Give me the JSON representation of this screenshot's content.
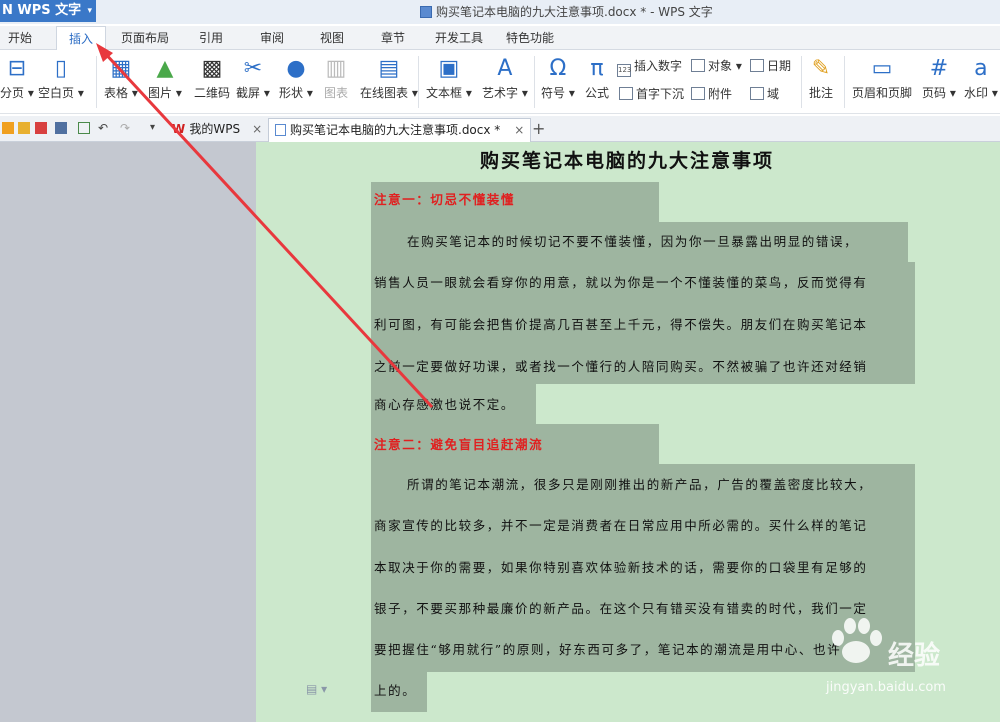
{
  "app": {
    "name": "WPS 文字"
  },
  "window": {
    "title": "购买笔记本电脑的九大注意事项.docx * - WPS 文字"
  },
  "menu_tabs": [
    "开始",
    "插入",
    "页面布局",
    "引用",
    "审阅",
    "视图",
    "章节",
    "开发工具",
    "特色功能"
  ],
  "ribbon": {
    "page_break": "分页",
    "blank_page": "空白页",
    "table": "表格",
    "picture": "图片",
    "qrcode": "二维码",
    "screenshot": "截屏",
    "shape": "形状",
    "chart": "图表",
    "online_chart": "在线图表",
    "textbox": "文本框",
    "wordart": "艺术字",
    "symbol": "符号",
    "formula": "公式",
    "insert_number": "插入数字",
    "object": "对象",
    "date": "日期",
    "dropcap": "首字下沉",
    "attachment": "附件",
    "field": "域",
    "comment": "批注",
    "header_footer": "页眉和页脚",
    "page_number": "页码",
    "watermark": "水印"
  },
  "doc_tabs": {
    "my_wps": "我的WPS",
    "current_doc": "购买笔记本电脑的九大注意事项.docx *",
    "new_tab": "+"
  },
  "document": {
    "title": "购买笔记本电脑的九大注意事项",
    "section1": {
      "heading": "注意一：切忌不懂装懂",
      "lines": [
        "在购买笔记本的时候切记不要不懂装懂，因为你一旦暴露出明显的错误，",
        "销售人员一眼就会看穿你的用意，就以为你是一个不懂装懂的菜鸟，反而觉得有",
        "利可图，有可能会把售价提高几百甚至上千元，得不偿失。朋友们在购买笔记本",
        "之前一定要做好功课，或者找一个懂行的人陪同购买。不然被骗了也许还对经销",
        "商心存感激也说不定。"
      ]
    },
    "section2": {
      "heading": "注意二：避免盲目追赶潮流",
      "lines": [
        "所谓的笔记本潮流，很多只是刚刚推出的新产品，广告的覆盖密度比较大，",
        "商家宣传的比较多，并不一定是消费者在日常应用中所必需的。买什么样的笔记",
        "本取决于你的需要，如果你特别喜欢体验新技术的话，需要你的口袋里有足够的",
        "银子，不要买那种最廉价的新产品。在这个只有错买没有错卖的时代，我们一定",
        "要把握住“够用就行”的原则，好东西可多了，笔记本的潮流是用中心、也许",
        "上的。"
      ]
    }
  },
  "watermark": {
    "brand": "经验",
    "url": "jingyan.baidu.com"
  },
  "colors": {
    "accent": "#2b6cc4",
    "heading_red": "#e02020",
    "highlight": "#9eb5a0",
    "page_bg": "#cce8cc",
    "annotation_arrow": "#e8383d"
  }
}
